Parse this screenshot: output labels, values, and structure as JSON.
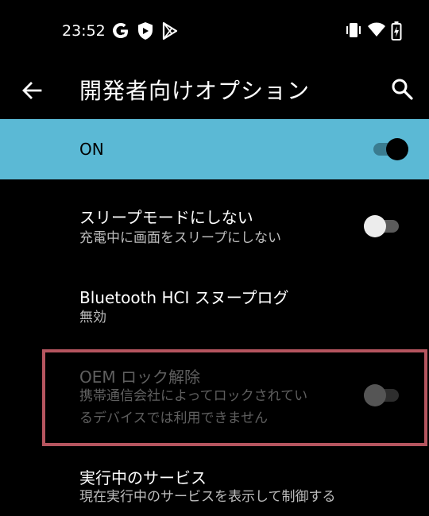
{
  "status_bar": {
    "time": "23:52",
    "left_icons": [
      "google-icon",
      "shield-icon",
      "play-store-icon"
    ],
    "right_icons": [
      "vibrate-icon",
      "wifi-icon",
      "battery-charging-icon"
    ]
  },
  "app_bar": {
    "title": "開発者向けオプション"
  },
  "master_switch": {
    "label": "ON",
    "checked": true,
    "background": "#5bb9d5"
  },
  "settings": [
    {
      "title": "スリープモードにしない",
      "subtitle": "充電中に画面をスリープにしない",
      "has_switch": true,
      "checked": false,
      "enabled": true
    },
    {
      "title": "Bluetooth HCI スヌープログ",
      "subtitle": "無効",
      "has_switch": false,
      "enabled": true
    },
    {
      "title": "OEM ロック解除",
      "subtitle_lines": [
        "携帯通信会社によってロックされてい",
        "るデバイスでは利用できません"
      ],
      "has_switch": true,
      "checked": false,
      "enabled": false,
      "highlighted": true
    },
    {
      "title": "実行中のサービス",
      "subtitle": "現在実行中のサービスを表示して制御する",
      "has_switch": false,
      "enabled": true
    }
  ],
  "colors": {
    "highlight_border": "#b5555f"
  }
}
